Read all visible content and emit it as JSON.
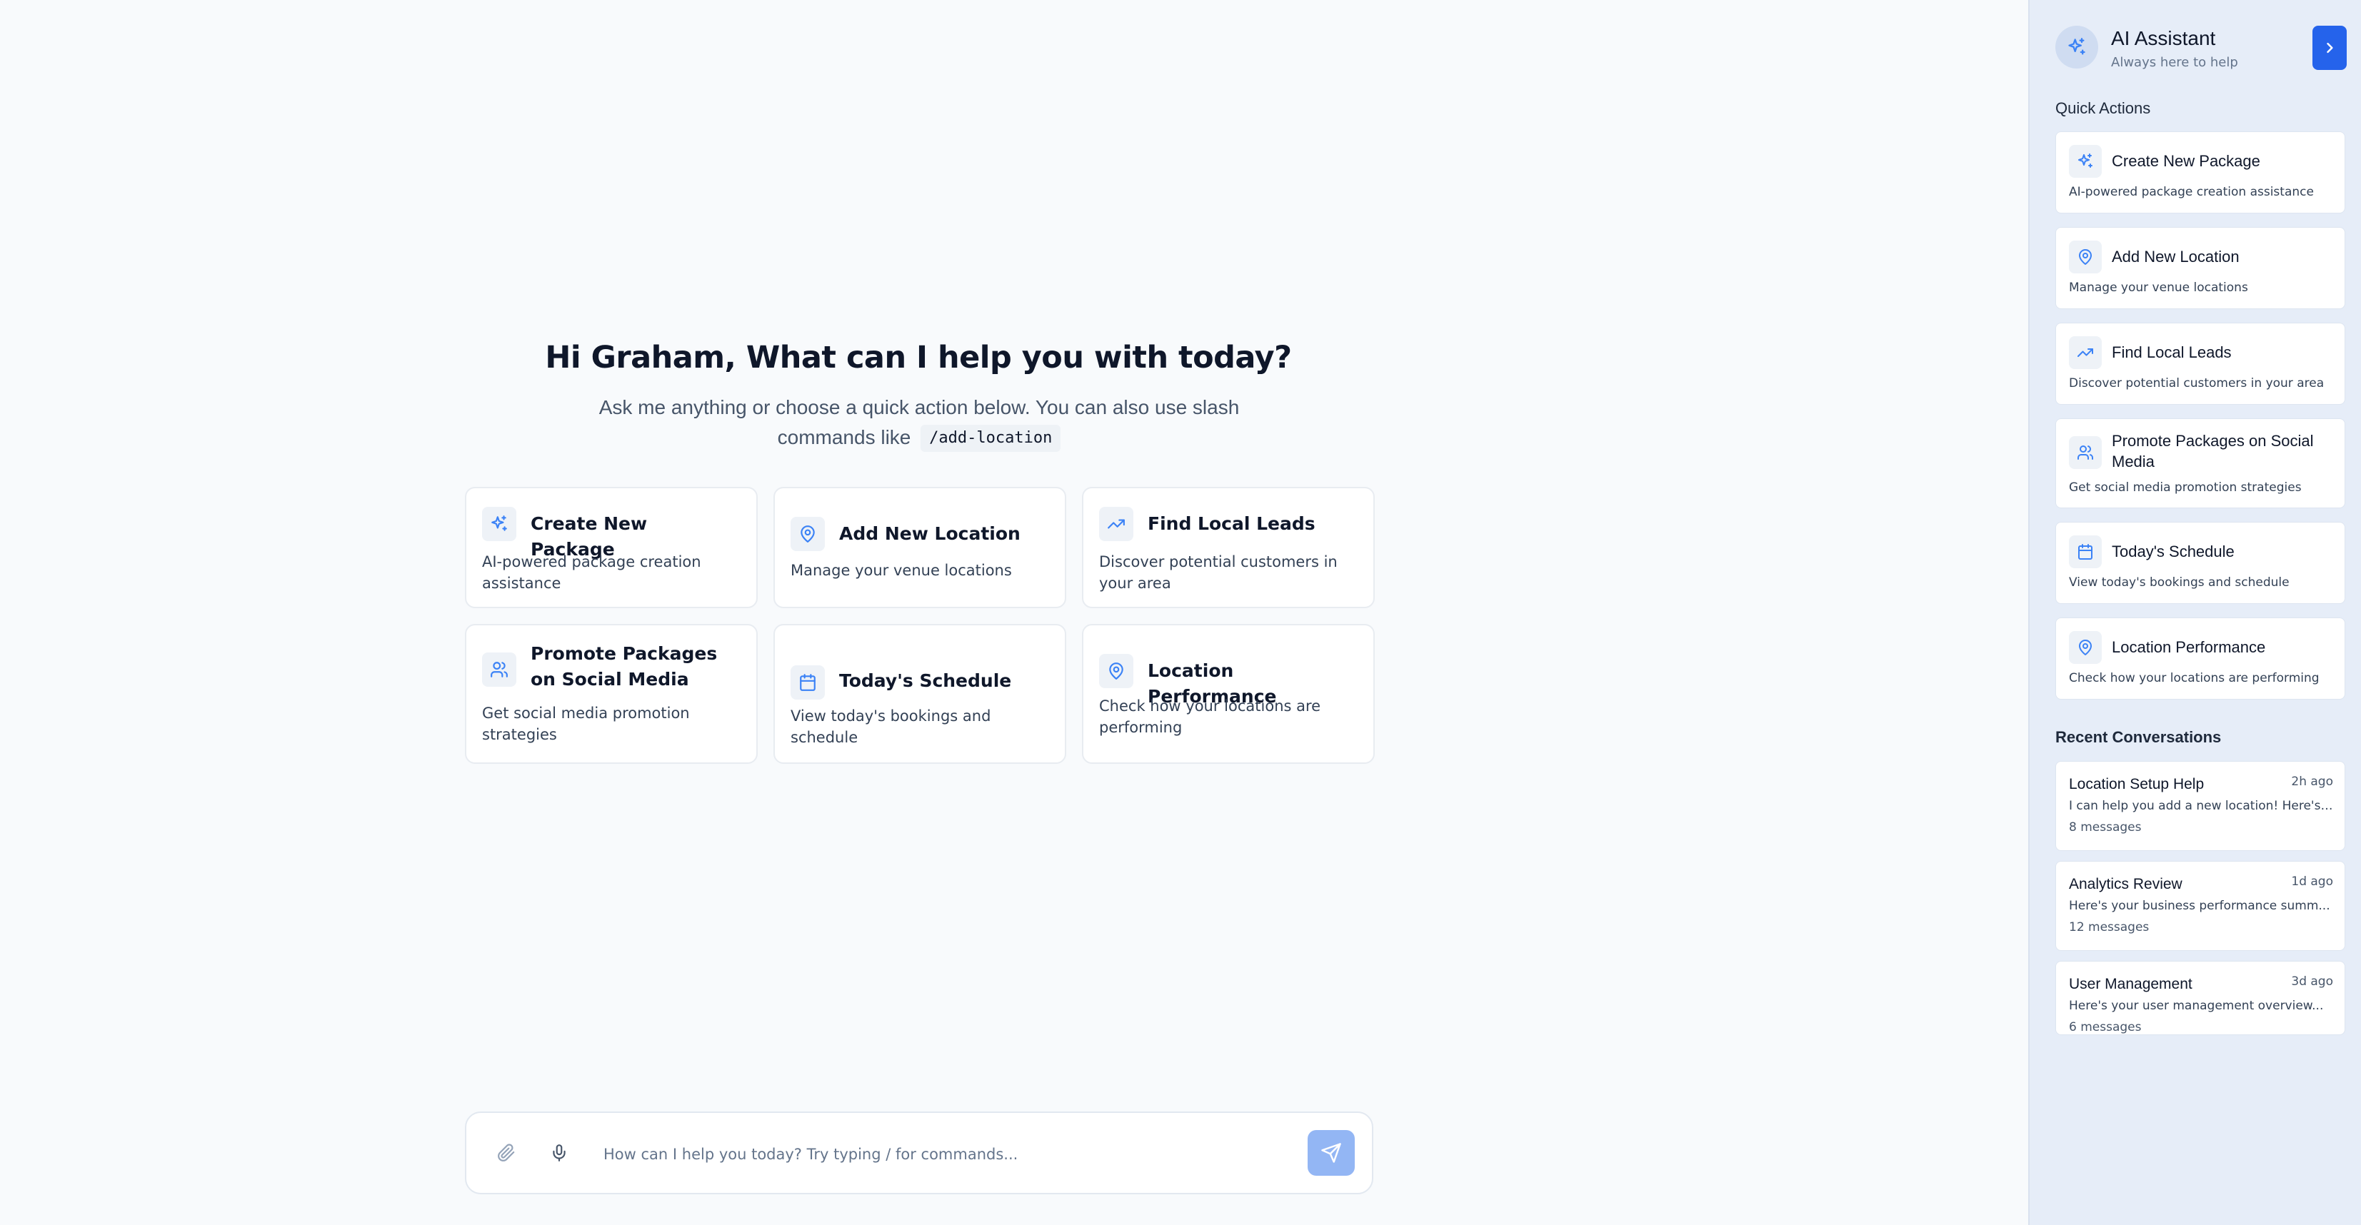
{
  "main": {
    "greeting": "Hi Graham, What can I help you with today?",
    "subtitle": "Ask me anything or choose a quick action below. You can also use slash commands like",
    "slash_example": "/add-location",
    "cards": [
      {
        "title": "Create New Package",
        "description": "AI-powered package creation assistance",
        "icon": "sparkles-icon"
      },
      {
        "title": "Add New Location",
        "description": "Manage your venue locations",
        "icon": "map-pin-icon"
      },
      {
        "title": "Find Local Leads",
        "description": "Discover potential customers in your area",
        "icon": "trending-up-icon"
      },
      {
        "title": "Promote Packages on Social Media",
        "description": "Get social media promotion strategies",
        "icon": "users-icon"
      },
      {
        "title": "Today's Schedule",
        "description": "View today's bookings and schedule",
        "icon": "calendar-icon"
      },
      {
        "title": "Location Performance",
        "description": "Check how your locations are performing",
        "icon": "map-pin-icon"
      }
    ],
    "input": {
      "placeholder": "How can I help you today? Try typing / for commands...",
      "value": ""
    }
  },
  "sidebar": {
    "title": "AI Assistant",
    "subtitle": "Always here to help",
    "quick_actions_label": "Quick Actions",
    "quick_actions": [
      {
        "title": "Create New Package",
        "description": "AI-powered package creation assistance",
        "icon": "sparkles-icon"
      },
      {
        "title": "Add New Location",
        "description": "Manage your venue locations",
        "icon": "map-pin-icon"
      },
      {
        "title": "Find Local Leads",
        "description": "Discover potential customers in your area",
        "icon": "trending-up-icon"
      },
      {
        "title": "Promote Packages on Social Media",
        "description": "Get social media promotion strategies",
        "icon": "users-icon"
      },
      {
        "title": "Today's Schedule",
        "description": "View today's bookings and schedule",
        "icon": "calendar-icon"
      },
      {
        "title": "Location Performance",
        "description": "Check how your locations are performing",
        "icon": "map-pin-icon"
      }
    ],
    "recent_label": "Recent Conversations",
    "conversations": [
      {
        "title": "Location Setup Help",
        "time": "2h ago",
        "preview": "I can help you add a new location! Here's ...",
        "count": "8 messages"
      },
      {
        "title": "Analytics Review",
        "time": "1d ago",
        "preview": "Here's your business performance summ...",
        "count": "12 messages"
      },
      {
        "title": "User Management",
        "time": "3d ago",
        "preview": "Here's your user management overview...",
        "count": "6 messages"
      }
    ]
  },
  "colors": {
    "accent": "#2563eb",
    "icon_blue": "#3b82f6",
    "send_button": "#93b6f4",
    "sidebar_bg": "#e6edf8",
    "page_bg": "#f8fafc"
  }
}
